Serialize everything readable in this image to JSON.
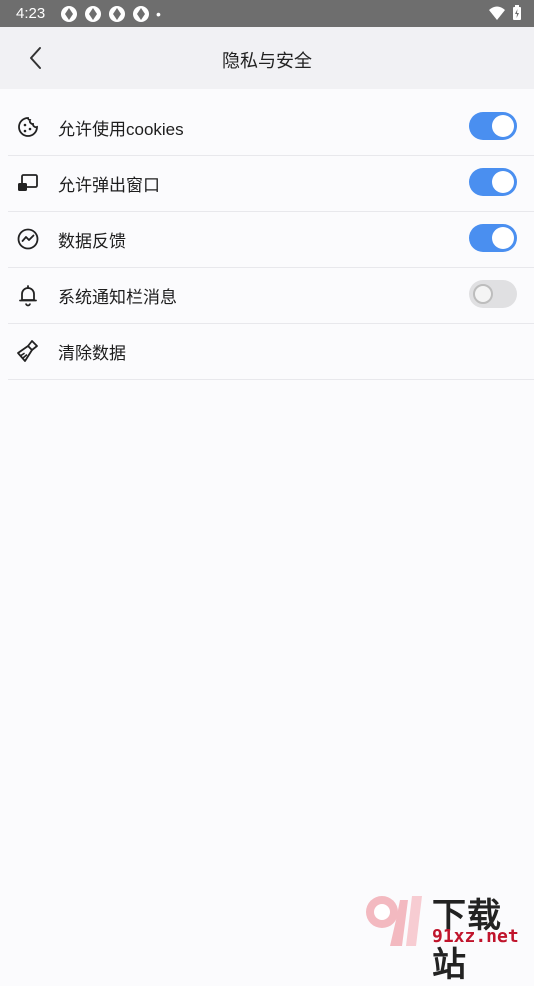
{
  "status_bar": {
    "time": "4:23",
    "dot": "•"
  },
  "header": {
    "title": "隐私与安全"
  },
  "settings": [
    {
      "label": "允许使用cookies",
      "icon": "cookie-icon",
      "toggle": true
    },
    {
      "label": "允许弹出窗口",
      "icon": "popup-window-icon",
      "toggle": true
    },
    {
      "label": "数据反馈",
      "icon": "feedback-chart-icon",
      "toggle": true
    },
    {
      "label": "系统通知栏消息",
      "icon": "bell-icon",
      "toggle": false
    },
    {
      "label": "清除数据",
      "icon": "broom-icon"
    }
  ],
  "watermark": {
    "brand_text": "下载站",
    "url_text": "91xz.net"
  },
  "colors": {
    "accent": "#4a8ff0",
    "toggle_off": "#e0e0e2",
    "status_bar": "#6e6e6e",
    "header_bg": "#f1f1f4"
  }
}
